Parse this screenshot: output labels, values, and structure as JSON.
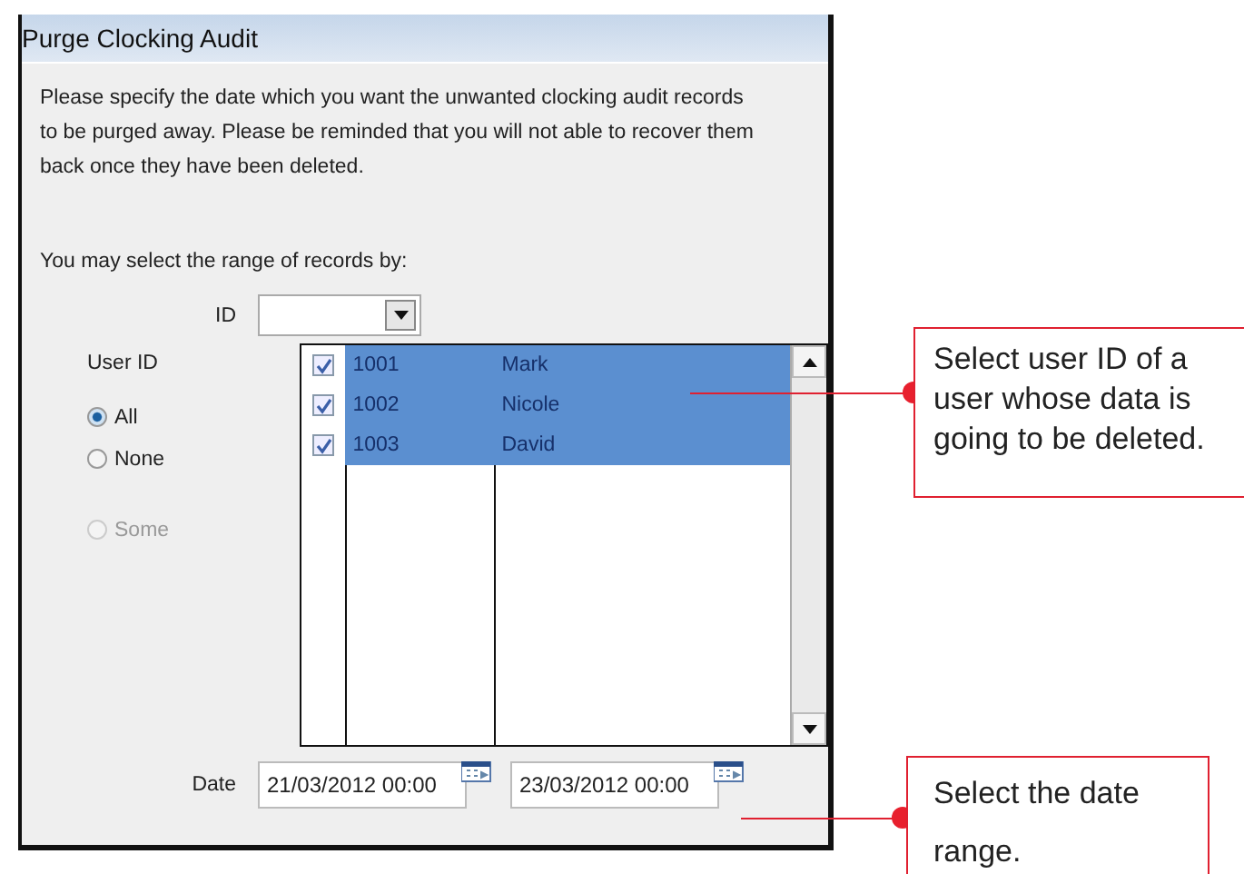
{
  "window": {
    "title": "Purge Clocking Audit"
  },
  "intro": "Please specify the date which you want the unwanted clocking audit records to be purged away. Please be reminded that you will not able to recover them back once they have been deleted.",
  "range_label": "You may select the range of records by:",
  "id_filter": {
    "label": "ID"
  },
  "user_id": {
    "label": "User ID",
    "options": [
      {
        "label": "All",
        "selected": true,
        "disabled": false
      },
      {
        "label": "None",
        "selected": false,
        "disabled": false
      },
      {
        "label": "Some",
        "selected": false,
        "disabled": true
      }
    ]
  },
  "users": [
    {
      "checked": true,
      "selected": true,
      "id": "1001",
      "name": "Mark"
    },
    {
      "checked": true,
      "selected": true,
      "id": "1002",
      "name": "Nicole"
    },
    {
      "checked": true,
      "selected": true,
      "id": "1003",
      "name": "David"
    }
  ],
  "date": {
    "label": "Date",
    "from": "21/03/2012 00:00",
    "to": "23/03/2012 00:00"
  },
  "callouts": [
    {
      "text": "Select user ID of a user whose data is going to be deleted."
    },
    {
      "text": "Select the date range."
    }
  ]
}
